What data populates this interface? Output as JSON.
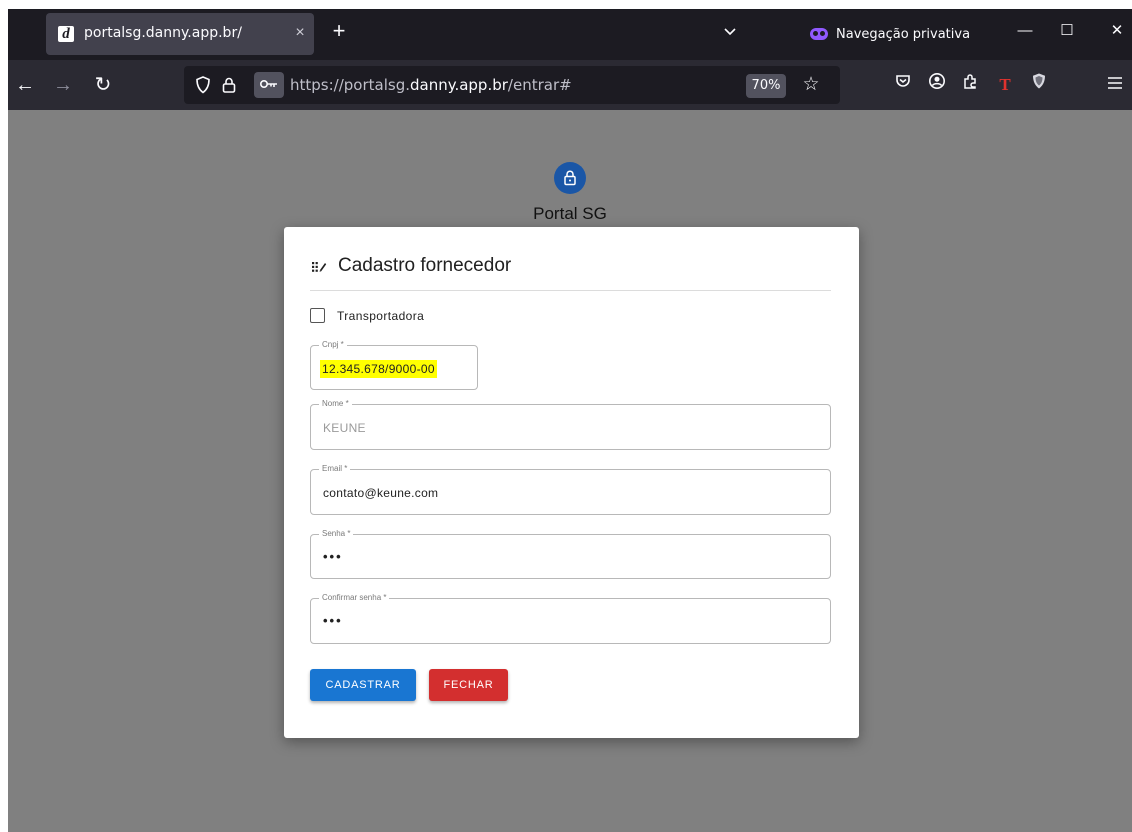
{
  "browser": {
    "tab": {
      "title": "portalsg.danny.app.br/",
      "favicon_letter": "d",
      "close_glyph": "×"
    },
    "new_tab_glyph": "+",
    "tab_list_glyph": "⌄",
    "private_label": "Navegação privativa",
    "window_controls": {
      "minimize": "—",
      "maximize": "☐",
      "close": "✕"
    },
    "nav": {
      "back": "←",
      "forward": "→",
      "reload": "↻"
    },
    "url": {
      "scheme": "https://portalsg.",
      "host": "danny.app.br",
      "path": "/entrar#"
    },
    "zoom": "70%",
    "star": "☆",
    "accent_private": "#9059ff"
  },
  "page": {
    "brand": {
      "title": "Portal SG",
      "color": "#1a56a6"
    },
    "dialog": {
      "title": "Cadastro fornecedor",
      "checkbox": {
        "label": "Transportadora",
        "checked": false
      },
      "fields": {
        "cnpj": {
          "label": "Cnpj *",
          "value": "12.345.678/9000-00"
        },
        "nome": {
          "label": "Nome *",
          "value": "KEUNE"
        },
        "email": {
          "label": "Email *",
          "value": "contato@keune.com"
        },
        "senha": {
          "label": "Senha *",
          "value": "•••"
        },
        "confirmar": {
          "label": "Confirmar senha *",
          "value": "•••"
        }
      },
      "buttons": {
        "register": {
          "label": "CADASTRAR",
          "color": "#1976d2"
        },
        "close": {
          "label": "FECHAR",
          "color": "#d32f2f"
        }
      }
    }
  }
}
